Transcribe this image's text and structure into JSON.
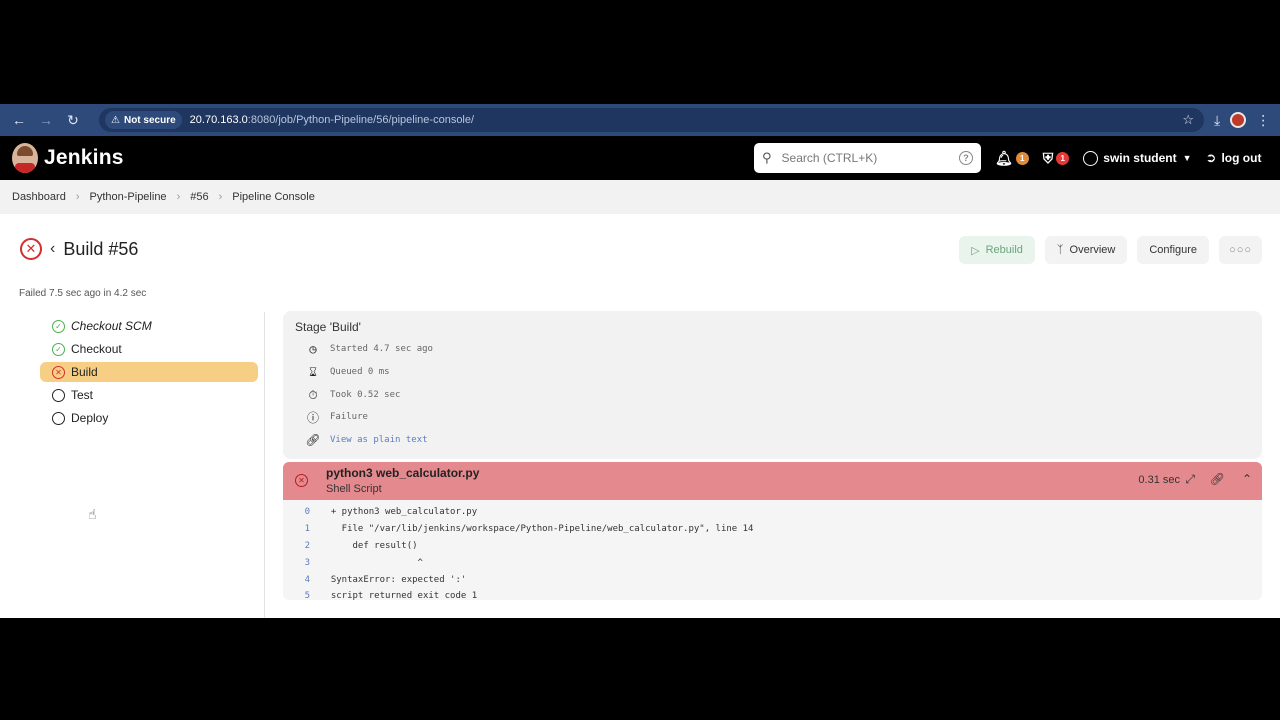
{
  "browser": {
    "secure_label": "Not secure",
    "url_host": "20.70.163.0",
    "url_path": ":8080/job/Python-Pipeline/56/pipeline-console/"
  },
  "header": {
    "title": "Jenkins",
    "search_placeholder": "Search (CTRL+K)",
    "notif_count": "1",
    "security_count": "1",
    "user_name": "swin student",
    "logout_label": "log out"
  },
  "breadcrumb": [
    "Dashboard",
    "Python-Pipeline",
    "#56",
    "Pipeline Console"
  ],
  "build": {
    "title": "Build #56",
    "status_text": "Failed 7.5 sec ago in 4.2 sec"
  },
  "actions": {
    "rebuild": "Rebuild",
    "overview": "Overview",
    "configure": "Configure"
  },
  "stages": [
    {
      "label": "Checkout SCM",
      "status": "success"
    },
    {
      "label": "Checkout",
      "status": "success"
    },
    {
      "label": "Build",
      "status": "failed"
    },
    {
      "label": "Test",
      "status": "pending"
    },
    {
      "label": "Deploy",
      "status": "pending"
    }
  ],
  "stage_info": {
    "name": "Stage 'Build'",
    "started": "Started 4.7 sec ago",
    "queued": "Queued 0 ms",
    "took": "Took 0.52 sec",
    "result": "Failure",
    "plain_text_link": "View as plain text"
  },
  "step": {
    "title": "python3 web_calculator.py",
    "subtitle": "Shell Script",
    "duration": "0.31 sec"
  },
  "log": [
    {
      "n": "0",
      "text": "  + python3 web_calculator.py"
    },
    {
      "n": "1",
      "text": "    File \"/var/lib/jenkins/workspace/Python-Pipeline/web_calculator.py\", line 14"
    },
    {
      "n": "2",
      "text": "      def result()"
    },
    {
      "n": "3",
      "text": "                  ^"
    },
    {
      "n": "4",
      "text": "  SyntaxError: expected ':'"
    },
    {
      "n": "5",
      "text": "  script returned exit code 1"
    }
  ],
  "colors": {
    "failure_red": "#d32f2f",
    "active_stage": "#f7cf84",
    "step_header": "#e48a8f",
    "link_blue": "#5b7cc2"
  }
}
